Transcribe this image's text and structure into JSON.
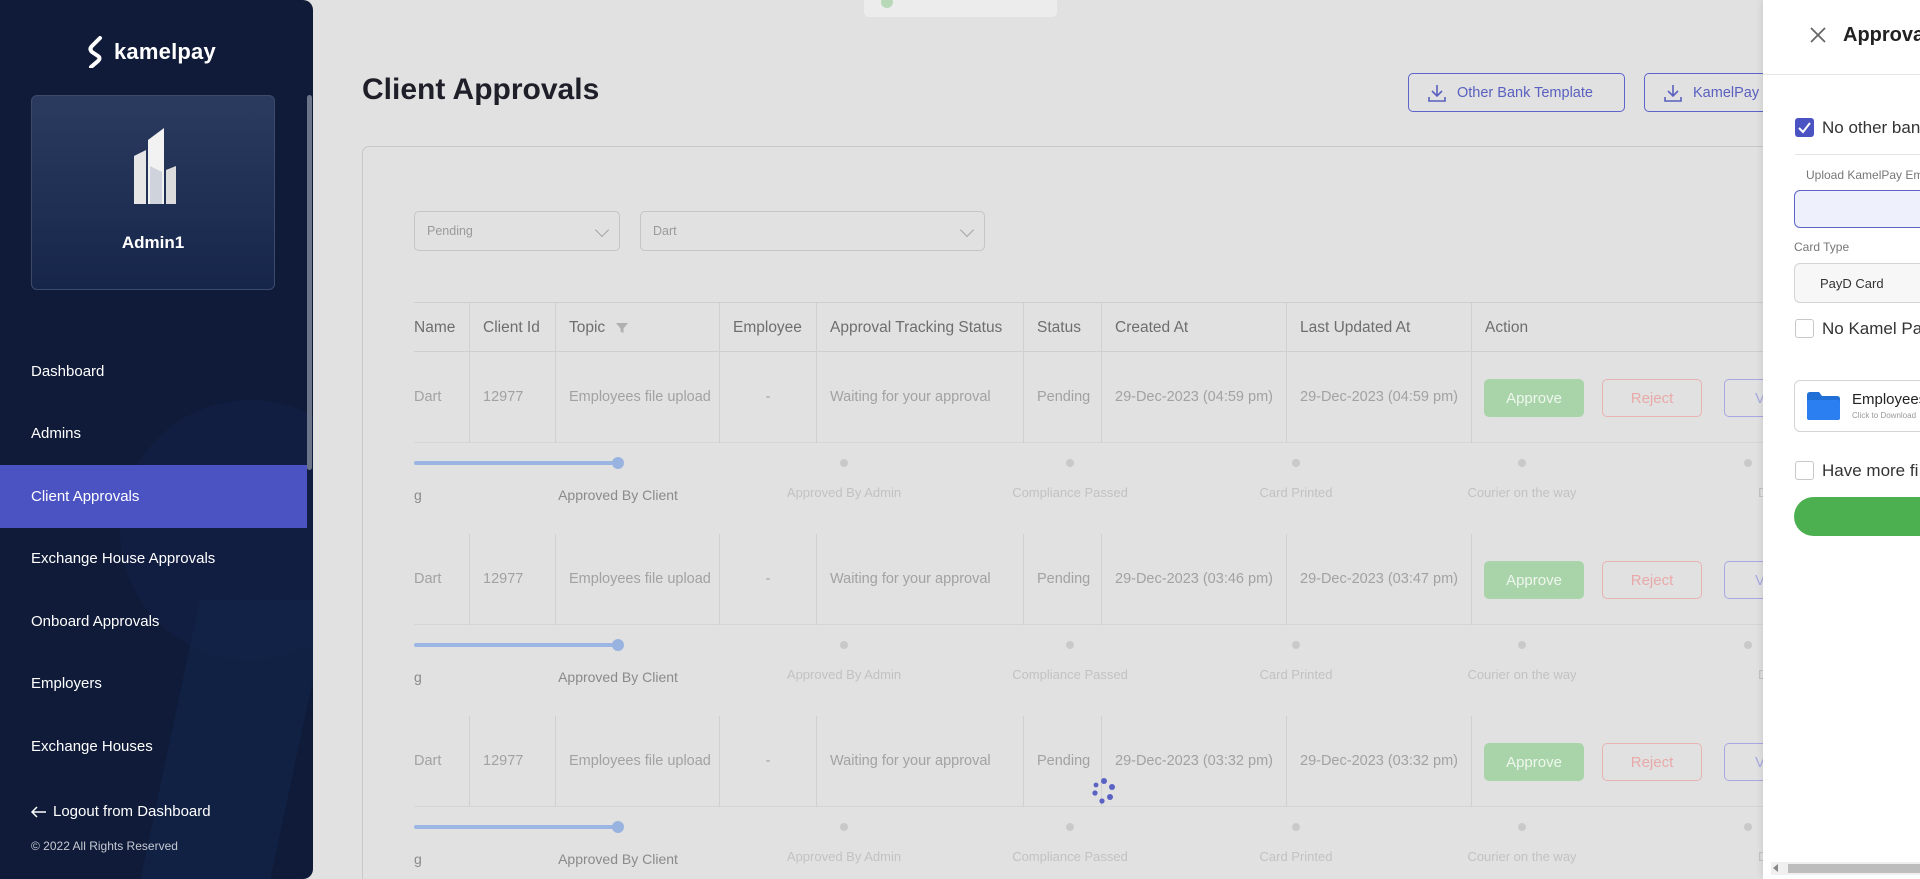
{
  "brand": {
    "name": "kamelpay"
  },
  "profile": {
    "name": "Admin1"
  },
  "sidebar": {
    "items": [
      {
        "label": "Dashboard"
      },
      {
        "label": "Admins"
      },
      {
        "label": "Client Approvals"
      },
      {
        "label": "Exchange House Approvals"
      },
      {
        "label": "Onboard Approvals"
      },
      {
        "label": "Employers"
      },
      {
        "label": "Exchange Houses"
      }
    ],
    "active_index": 2,
    "logout_label": "Logout from Dashboard",
    "copyright": "© 2022 All Rights Reserved"
  },
  "page": {
    "title": "Client Approvals",
    "buttons": {
      "other_bank": "Other Bank Template",
      "kamelpay": "KamelPay"
    }
  },
  "filters": {
    "status": "Pending",
    "client": "Dart"
  },
  "table": {
    "columns": [
      "Name",
      "Client Id",
      "Topic",
      "Employee",
      "Approval Tracking Status",
      "Status",
      "Created At",
      "Last Updated At",
      "Action"
    ],
    "rows": [
      {
        "name": "Dart",
        "client_id": "12977",
        "topic": "Employees file upload",
        "employee": "-",
        "tracking": "Waiting for your approval",
        "status": "Pending",
        "created": "29-Dec-2023 (04:59 pm)",
        "updated": "29-Dec-2023 (04:59 pm)"
      },
      {
        "name": "Dart",
        "client_id": "12977",
        "topic": "Employees file upload",
        "employee": "-",
        "tracking": "Waiting for your approval",
        "status": "Pending",
        "created": "29-Dec-2023 (03:46 pm)",
        "updated": "29-Dec-2023 (03:47 pm)"
      },
      {
        "name": "Dart",
        "client_id": "12977",
        "topic": "Employees file upload",
        "employee": "-",
        "tracking": "Waiting for your approval",
        "status": "Pending",
        "created": "29-Dec-2023 (03:32 pm)",
        "updated": "29-Dec-2023 (03:32 pm)"
      }
    ],
    "actions": {
      "approve": "Approve",
      "reject": "Reject",
      "view": "V"
    },
    "tracker": {
      "edge_label": "g",
      "steps": [
        "Approved By Client",
        "Approved By Admin",
        "Compliance Passed",
        "Card Printed",
        "Courier on the way",
        "Delive"
      ]
    }
  },
  "drawer": {
    "title": "Approva",
    "no_other_bank_label": "No other ban",
    "upload_label": "Upload KamelPay Em",
    "card_type_label": "Card Type",
    "card_type_value": "PayD Card",
    "no_kamel_label": "No Kamel Pa",
    "file_name": "Employees",
    "file_sub": "Click to Download",
    "have_more_label": "Have more fi"
  },
  "colors": {
    "sidebar_bg": "#0f1b38",
    "active_nav": "#4b53c3",
    "accent": "#5c63c9",
    "approve": "#4caf50",
    "reject": "#e57373"
  }
}
